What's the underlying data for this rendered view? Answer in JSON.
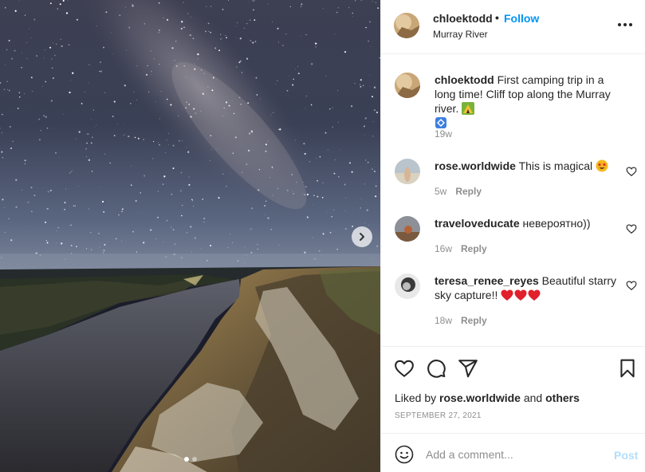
{
  "post": {
    "username": "chloektodd",
    "separator": "•",
    "follow_label": "Follow",
    "location": "Murray River",
    "more_icon": "more-horizontal-icon"
  },
  "caption": {
    "username": "chloektodd",
    "text": "First camping trip in a long time! Cliff top along the Murray river.",
    "emojis": [
      "camping-emoji",
      "blue-diamond-emoji"
    ],
    "time": "19w"
  },
  "comments": [
    {
      "username": "rose.worldwide",
      "text": "This is magical",
      "emoji": "star-struck-emoji",
      "time": "5w",
      "reply_label": "Reply"
    },
    {
      "username": "traveloveducate",
      "text": "невероятно))",
      "time": "16w",
      "reply_label": "Reply"
    },
    {
      "username": "teresa_renee_reyes",
      "text": "Beautiful starry sky capture!!",
      "emoji": "red-hearts-emoji",
      "time": "18w",
      "reply_label": "Reply"
    }
  ],
  "likes": {
    "prefix": "Liked by",
    "user": "rose.worldwide",
    "and": "and",
    "others": "others"
  },
  "date": "SEPTEMBER 27, 2021",
  "add_comment": {
    "placeholder": "Add a comment...",
    "post_label": "Post"
  },
  "carousel": {
    "slides": 2,
    "active": 1
  },
  "colors": {
    "link_blue": "#0095f6",
    "post_disabled": "#b2dffc",
    "meta_gray": "#8e8e8e",
    "heart_red": "#ed4956"
  }
}
